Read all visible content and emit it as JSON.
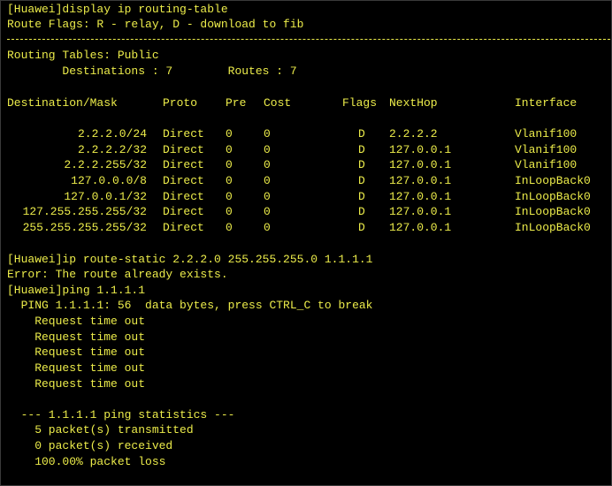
{
  "terminal": {
    "lines_top": [
      "[Huawei]display ip routing-table",
      "Route Flags: R - relay, D - download to fib",
      "Routing Tables: Public",
      "        Destinations : 7        Routes : 7"
    ],
    "headers": {
      "destination": "Destination/Mask",
      "proto": "Proto",
      "pre": "Pre",
      "cost": "Cost",
      "flags": "Flags",
      "nexthop": "NextHop",
      "interface": "Interface"
    },
    "routes": [
      {
        "destination": "2.2.2.0/24",
        "proto": "Direct",
        "pre": "0",
        "cost": "0",
        "flags": "D",
        "nexthop": "2.2.2.2",
        "interface": "Vlanif100"
      },
      {
        "destination": "2.2.2.2/32",
        "proto": "Direct",
        "pre": "0",
        "cost": "0",
        "flags": "D",
        "nexthop": "127.0.0.1",
        "interface": "Vlanif100"
      },
      {
        "destination": "2.2.2.255/32",
        "proto": "Direct",
        "pre": "0",
        "cost": "0",
        "flags": "D",
        "nexthop": "127.0.0.1",
        "interface": "Vlanif100"
      },
      {
        "destination": "127.0.0.0/8",
        "proto": "Direct",
        "pre": "0",
        "cost": "0",
        "flags": "D",
        "nexthop": "127.0.0.1",
        "interface": "InLoopBack0"
      },
      {
        "destination": "127.0.0.1/32",
        "proto": "Direct",
        "pre": "0",
        "cost": "0",
        "flags": "D",
        "nexthop": "127.0.0.1",
        "interface": "InLoopBack0"
      },
      {
        "destination": "127.255.255.255/32",
        "proto": "Direct",
        "pre": "0",
        "cost": "0",
        "flags": "D",
        "nexthop": "127.0.0.1",
        "interface": "InLoopBack0"
      },
      {
        "destination": "255.255.255.255/32",
        "proto": "Direct",
        "pre": "0",
        "cost": "0",
        "flags": "D",
        "nexthop": "127.0.0.1",
        "interface": "InLoopBack0"
      }
    ],
    "lines_bottom": [
      "[Huawei]ip route-static 2.2.2.0 255.255.255.0 1.1.1.1",
      "Error: The route already exists.",
      "[Huawei]ping 1.1.1.1",
      "  PING 1.1.1.1: 56  data bytes, press CTRL_C to break",
      "    Request time out",
      "    Request time out",
      "    Request time out",
      "    Request time out",
      "    Request time out",
      "",
      "  --- 1.1.1.1 ping statistics ---",
      "    5 packet(s) transmitted",
      "    0 packet(s) received",
      "    100.00% packet loss"
    ]
  },
  "colors": {
    "background": "#000000",
    "text": "#ecec4a"
  }
}
